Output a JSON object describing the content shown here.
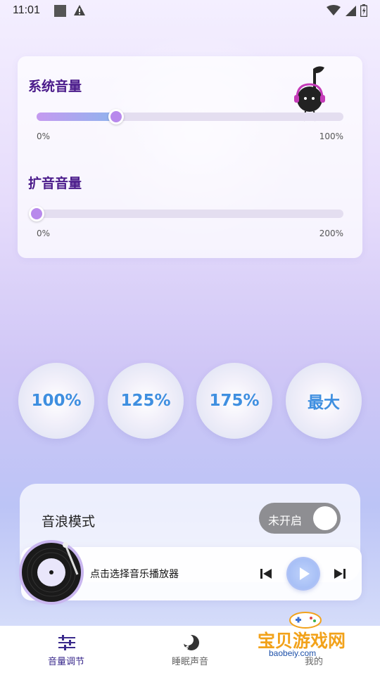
{
  "status_bar": {
    "time": "11:01"
  },
  "volume_card": {
    "system": {
      "title": "系统音量",
      "min_label": "0%",
      "max_label": "100%",
      "value_fraction": 0.26
    },
    "boost": {
      "title": "扩音音量",
      "min_label": "0%",
      "max_label": "200%",
      "value_fraction": 0.0
    }
  },
  "presets": [
    "100%",
    "125%",
    "175%",
    "最大"
  ],
  "wave_mode": {
    "title": "音浪模式",
    "toggle_label": "未开启",
    "enabled": false
  },
  "player": {
    "prompt": "点击选择音乐播放器"
  },
  "nav": {
    "items": [
      {
        "label": "音量调节",
        "active": true
      },
      {
        "label": "睡眠声音",
        "active": false
      },
      {
        "label": "我的",
        "active": false
      }
    ]
  },
  "watermark": {
    "title": "宝贝游戏网",
    "url": "baobeiy.com"
  },
  "colors": {
    "accent": "#4a1a8a",
    "preset_text": "#3f8fe0",
    "nav_active": "#3a2a8c",
    "nav_inactive": "#666666"
  }
}
